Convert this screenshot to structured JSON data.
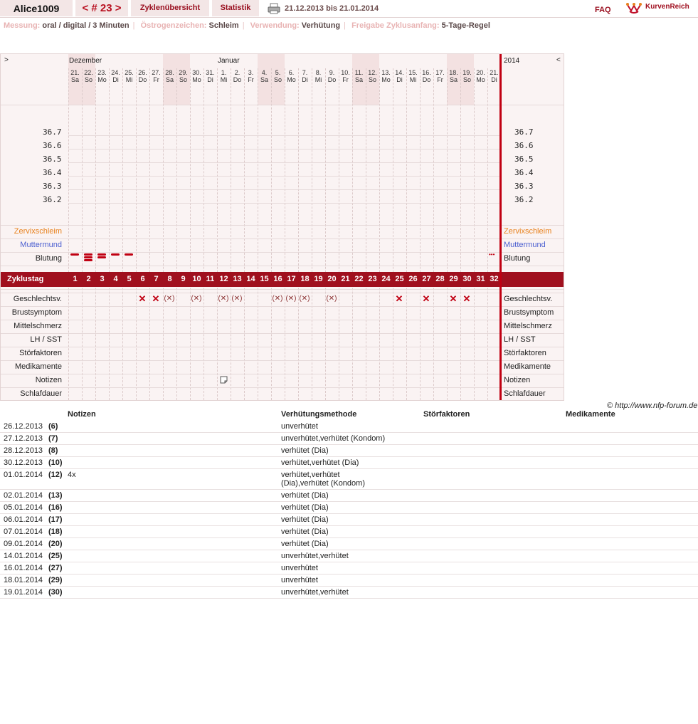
{
  "header": {
    "username": "Alice1009",
    "cycle_nav": "< # 23 >",
    "tab_overview": "Zyklenübersicht",
    "tab_stats": "Statistik",
    "date_range": "21.12.2013 bis 21.01.2014",
    "faq": "FAQ",
    "logo_text": "KurvenReich"
  },
  "settings": [
    {
      "label": "Messung:",
      "value": "oral / digital / 3 Minuten"
    },
    {
      "label": "Östrogenzeichen:",
      "value": "Schleim"
    },
    {
      "label": "Verwendung:",
      "value": "Verhütung"
    },
    {
      "label": "Freigabe Zyklusanfang:",
      "value": "5-Tage-Regel"
    }
  ],
  "chart": {
    "nav_left": ">",
    "nav_right": "<",
    "year": "2014",
    "months": [
      {
        "name": "Dezember",
        "start_index": 0
      },
      {
        "name": "Januar",
        "start_index": 11
      }
    ],
    "days": [
      {
        "d": "21.",
        "w": "Sa",
        "we": true
      },
      {
        "d": "22.",
        "w": "So",
        "we": true
      },
      {
        "d": "23.",
        "w": "Mo"
      },
      {
        "d": "24.",
        "w": "Di"
      },
      {
        "d": "25.",
        "w": "Mi"
      },
      {
        "d": "26.",
        "w": "Do"
      },
      {
        "d": "27.",
        "w": "Fr"
      },
      {
        "d": "28.",
        "w": "Sa",
        "we": true
      },
      {
        "d": "29.",
        "w": "So",
        "we": true
      },
      {
        "d": "30.",
        "w": "Mo"
      },
      {
        "d": "31.",
        "w": "Di"
      },
      {
        "d": "1.",
        "w": "Mi"
      },
      {
        "d": "2.",
        "w": "Do"
      },
      {
        "d": "3.",
        "w": "Fr"
      },
      {
        "d": "4.",
        "w": "Sa",
        "we": true
      },
      {
        "d": "5.",
        "w": "So",
        "we": true
      },
      {
        "d": "6.",
        "w": "Mo"
      },
      {
        "d": "7.",
        "w": "Di"
      },
      {
        "d": "8.",
        "w": "Mi"
      },
      {
        "d": "9.",
        "w": "Do"
      },
      {
        "d": "10.",
        "w": "Fr"
      },
      {
        "d": "11.",
        "w": "Sa",
        "we": true
      },
      {
        "d": "12.",
        "w": "So",
        "we": true
      },
      {
        "d": "13.",
        "w": "Mo"
      },
      {
        "d": "14.",
        "w": "Di"
      },
      {
        "d": "15.",
        "w": "Mi"
      },
      {
        "d": "16.",
        "w": "Do"
      },
      {
        "d": "17.",
        "w": "Fr"
      },
      {
        "d": "18.",
        "w": "Sa",
        "we": true
      },
      {
        "d": "19.",
        "w": "So",
        "we": true
      },
      {
        "d": "20.",
        "w": "Mo"
      },
      {
        "d": "21.",
        "w": "Di"
      }
    ],
    "temps": [
      "36.7",
      "36.6",
      "36.5",
      "36.4",
      "36.3",
      "36.2"
    ],
    "row_labels": {
      "zervix": "Zervixschleim",
      "muttermund": "Muttermund",
      "blutung": "Blutung",
      "zyklustag": "Zyklustag",
      "geschlecht": "Geschlechtsv.",
      "brust": "Brustsymptom",
      "mittel": "Mittelschmerz",
      "lh": "LH / SST",
      "stoer": "Störfaktoren",
      "medi": "Medikamente",
      "notizen": "Notizen",
      "schlaf": "Schlafdauer"
    },
    "colors": {
      "zervix": "#e8821e",
      "muttermund": "#4a5ed0",
      "accent": "#a0101e"
    },
    "cycle_days": [
      1,
      2,
      3,
      4,
      5,
      6,
      7,
      8,
      9,
      10,
      11,
      12,
      13,
      14,
      15,
      16,
      17,
      18,
      19,
      20,
      21,
      22,
      23,
      24,
      25,
      26,
      27,
      28,
      29,
      30,
      31,
      32
    ],
    "bleeding": [
      {
        "day": 1,
        "level": 1
      },
      {
        "day": 2,
        "level": 3
      },
      {
        "day": 3,
        "level": 2
      },
      {
        "day": 4,
        "level": 1
      },
      {
        "day": 5,
        "level": 1
      }
    ],
    "bleeding_more": {
      "day": 32,
      "text": "•••"
    },
    "intercourse": [
      {
        "day": 6,
        "type": "x"
      },
      {
        "day": 7,
        "type": "x"
      },
      {
        "day": 8,
        "type": "p"
      },
      {
        "day": 10,
        "type": "p"
      },
      {
        "day": 12,
        "type": "p"
      },
      {
        "day": 13,
        "type": "p"
      },
      {
        "day": 16,
        "type": "p"
      },
      {
        "day": 17,
        "type": "p"
      },
      {
        "day": 18,
        "type": "p"
      },
      {
        "day": 20,
        "type": "p"
      },
      {
        "day": 25,
        "type": "x"
      },
      {
        "day": 27,
        "type": "x"
      },
      {
        "day": 29,
        "type": "x"
      },
      {
        "day": 30,
        "type": "x"
      }
    ],
    "x_symbol": "✕",
    "p_symbol": "(✕)",
    "note_icon_day": 12
  },
  "copyright": "© http://www.nfp-forum.de",
  "notes_table": {
    "headers": [
      "Notizen",
      "Verhütungsmethode",
      "Störfaktoren",
      "Medikamente"
    ],
    "rows": [
      {
        "date": "26.12.2013",
        "day": "(6)",
        "note": "",
        "method": "unverhütet"
      },
      {
        "date": "27.12.2013",
        "day": "(7)",
        "note": "",
        "method": "unverhütet,verhütet (Kondom)"
      },
      {
        "date": "28.12.2013",
        "day": "(8)",
        "note": "",
        "method": "verhütet (Dia)"
      },
      {
        "date": "30.12.2013",
        "day": "(10)",
        "note": "",
        "method": "verhütet,verhütet (Dia)"
      },
      {
        "date": "01.01.2014",
        "day": "(12)",
        "note": "4x",
        "method": "verhütet,verhütet\n(Dia),verhütet (Kondom)"
      },
      {
        "date": "02.01.2014",
        "day": "(13)",
        "note": "",
        "method": "verhütet (Dia)"
      },
      {
        "date": "05.01.2014",
        "day": "(16)",
        "note": "",
        "method": "verhütet (Dia)"
      },
      {
        "date": "06.01.2014",
        "day": "(17)",
        "note": "",
        "method": "verhütet (Dia)"
      },
      {
        "date": "07.01.2014",
        "day": "(18)",
        "note": "",
        "method": "verhütet (Dia)"
      },
      {
        "date": "09.01.2014",
        "day": "(20)",
        "note": "",
        "method": "verhütet (Dia)"
      },
      {
        "date": "14.01.2014",
        "day": "(25)",
        "note": "",
        "method": "unverhütet,verhütet"
      },
      {
        "date": "16.01.2014",
        "day": "(27)",
        "note": "",
        "method": "unverhütet"
      },
      {
        "date": "18.01.2014",
        "day": "(29)",
        "note": "",
        "method": "unverhütet"
      },
      {
        "date": "19.01.2014",
        "day": "(30)",
        "note": "",
        "method": "unverhütet,verhütet"
      }
    ]
  }
}
